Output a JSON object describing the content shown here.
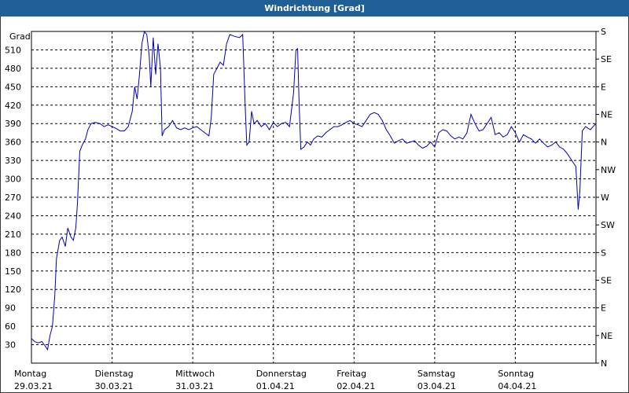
{
  "window": {
    "title": "Windrichtung [Grad]"
  },
  "colors": {
    "titlebar": "#1f5f96",
    "line": "#0000b4",
    "grid": "#000000"
  },
  "chart_data": {
    "type": "line",
    "title": "Windrichtung [Grad]",
    "ylabel": "Grad",
    "ylim": [
      0,
      540
    ],
    "y_ticks": [
      30,
      60,
      90,
      120,
      150,
      180,
      210,
      240,
      270,
      300,
      330,
      360,
      390,
      420,
      450,
      480,
      510
    ],
    "right_axis_labels": [
      "N",
      "NE",
      "E",
      "SE",
      "S",
      "SW",
      "W",
      "NW",
      "N",
      "NE",
      "E",
      "SE",
      "S"
    ],
    "right_axis_values": [
      0,
      45,
      90,
      135,
      180,
      225,
      270,
      315,
      360,
      405,
      450,
      495,
      540
    ],
    "x_day_labels": [
      {
        "day": "Montag",
        "date": "29.03.21"
      },
      {
        "day": "Dienstag",
        "date": "30.03.21"
      },
      {
        "day": "Mittwoch",
        "date": "31.03.21"
      },
      {
        "day": "Donnerstag",
        "date": "01.04.21"
      },
      {
        "day": "Freitag",
        "date": "02.04.21"
      },
      {
        "day": "Samstag",
        "date": "03.04.21"
      },
      {
        "day": "Sonntag",
        "date": "04.04.21"
      }
    ],
    "x_unit": "days since Montag 29.03.21 00:00",
    "xlim": [
      0,
      7
    ],
    "grid": true,
    "series": [
      {
        "name": "Windrichtung",
        "points": [
          [
            0.0,
            40
          ],
          [
            0.04,
            35
          ],
          [
            0.08,
            33
          ],
          [
            0.13,
            35
          ],
          [
            0.17,
            28
          ],
          [
            0.2,
            22
          ],
          [
            0.23,
            45
          ],
          [
            0.26,
            60
          ],
          [
            0.29,
            110
          ],
          [
            0.31,
            170
          ],
          [
            0.35,
            200
          ],
          [
            0.38,
            205
          ],
          [
            0.42,
            190
          ],
          [
            0.45,
            220
          ],
          [
            0.49,
            205
          ],
          [
            0.52,
            200
          ],
          [
            0.55,
            220
          ],
          [
            0.57,
            260
          ],
          [
            0.6,
            345
          ],
          [
            0.63,
            355
          ],
          [
            0.67,
            365
          ],
          [
            0.7,
            380
          ],
          [
            0.74,
            390
          ],
          [
            0.79,
            392
          ],
          [
            0.85,
            390
          ],
          [
            0.9,
            385
          ],
          [
            0.95,
            388
          ],
          [
            1.0,
            385
          ],
          [
            1.05,
            382
          ],
          [
            1.1,
            378
          ],
          [
            1.15,
            378
          ],
          [
            1.2,
            385
          ],
          [
            1.25,
            410
          ],
          [
            1.28,
            450
          ],
          [
            1.31,
            430
          ],
          [
            1.34,
            470
          ],
          [
            1.37,
            520
          ],
          [
            1.4,
            540
          ],
          [
            1.43,
            535
          ],
          [
            1.46,
            500
          ],
          [
            1.48,
            450
          ],
          [
            1.51,
            530
          ],
          [
            1.54,
            470
          ],
          [
            1.57,
            520
          ],
          [
            1.6,
            480
          ],
          [
            1.62,
            370
          ],
          [
            1.65,
            380
          ],
          [
            1.7,
            385
          ],
          [
            1.75,
            395
          ],
          [
            1.8,
            383
          ],
          [
            1.85,
            380
          ],
          [
            1.9,
            383
          ],
          [
            1.95,
            380
          ],
          [
            2.0,
            383
          ],
          [
            2.05,
            385
          ],
          [
            2.1,
            380
          ],
          [
            2.15,
            375
          ],
          [
            2.2,
            370
          ],
          [
            2.23,
            400
          ],
          [
            2.26,
            470
          ],
          [
            2.3,
            480
          ],
          [
            2.34,
            490
          ],
          [
            2.38,
            485
          ],
          [
            2.42,
            520
          ],
          [
            2.46,
            535
          ],
          [
            2.52,
            532
          ],
          [
            2.58,
            530
          ],
          [
            2.62,
            535
          ],
          [
            2.65,
            420
          ],
          [
            2.67,
            355
          ],
          [
            2.7,
            360
          ],
          [
            2.73,
            410
          ],
          [
            2.76,
            390
          ],
          [
            2.8,
            395
          ],
          [
            2.85,
            385
          ],
          [
            2.9,
            390
          ],
          [
            2.95,
            380
          ],
          [
            3.0,
            392
          ],
          [
            3.05,
            385
          ],
          [
            3.1,
            390
          ],
          [
            3.15,
            392
          ],
          [
            3.2,
            385
          ],
          [
            3.25,
            440
          ],
          [
            3.28,
            510
          ],
          [
            3.3,
            512
          ],
          [
            3.32,
            420
          ],
          [
            3.34,
            348
          ],
          [
            3.38,
            352
          ],
          [
            3.42,
            360
          ],
          [
            3.46,
            355
          ],
          [
            3.5,
            365
          ],
          [
            3.55,
            370
          ],
          [
            3.6,
            368
          ],
          [
            3.65,
            375
          ],
          [
            3.7,
            380
          ],
          [
            3.75,
            385
          ],
          [
            3.8,
            385
          ],
          [
            3.85,
            388
          ],
          [
            3.9,
            392
          ],
          [
            3.95,
            395
          ],
          [
            4.0,
            390
          ],
          [
            4.05,
            388
          ],
          [
            4.1,
            385
          ],
          [
            4.15,
            395
          ],
          [
            4.2,
            405
          ],
          [
            4.25,
            408
          ],
          [
            4.3,
            405
          ],
          [
            4.35,
            395
          ],
          [
            4.4,
            380
          ],
          [
            4.45,
            370
          ],
          [
            4.5,
            358
          ],
          [
            4.55,
            362
          ],
          [
            4.6,
            365
          ],
          [
            4.65,
            358
          ],
          [
            4.7,
            360
          ],
          [
            4.75,
            362
          ],
          [
            4.8,
            355
          ],
          [
            4.85,
            350
          ],
          [
            4.9,
            353
          ],
          [
            4.95,
            360
          ],
          [
            5.0,
            352
          ],
          [
            5.05,
            375
          ],
          [
            5.1,
            380
          ],
          [
            5.15,
            378
          ],
          [
            5.2,
            370
          ],
          [
            5.25,
            365
          ],
          [
            5.3,
            368
          ],
          [
            5.35,
            365
          ],
          [
            5.4,
            375
          ],
          [
            5.45,
            405
          ],
          [
            5.5,
            390
          ],
          [
            5.55,
            378
          ],
          [
            5.6,
            380
          ],
          [
            5.65,
            390
          ],
          [
            5.7,
            400
          ],
          [
            5.75,
            372
          ],
          [
            5.8,
            375
          ],
          [
            5.85,
            368
          ],
          [
            5.9,
            372
          ],
          [
            5.95,
            385
          ],
          [
            6.0,
            375
          ],
          [
            6.05,
            360
          ],
          [
            6.1,
            372
          ],
          [
            6.15,
            368
          ],
          [
            6.2,
            365
          ],
          [
            6.25,
            358
          ],
          [
            6.3,
            365
          ],
          [
            6.35,
            358
          ],
          [
            6.4,
            352
          ],
          [
            6.45,
            355
          ],
          [
            6.5,
            360
          ],
          [
            6.55,
            352
          ],
          [
            6.6,
            348
          ],
          [
            6.65,
            340
          ],
          [
            6.7,
            330
          ],
          [
            6.75,
            320
          ],
          [
            6.78,
            250
          ],
          [
            6.8,
            280
          ],
          [
            6.83,
            378
          ],
          [
            6.87,
            385
          ],
          [
            6.93,
            380
          ],
          [
            7.0,
            390
          ]
        ]
      }
    ]
  }
}
